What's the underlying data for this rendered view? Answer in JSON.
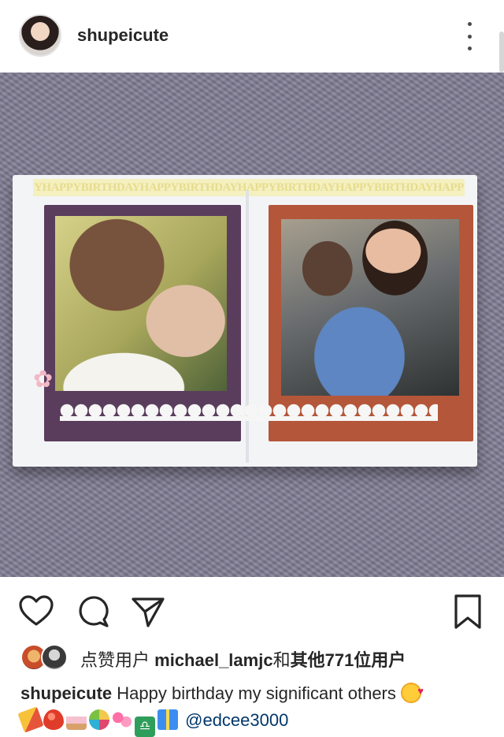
{
  "post": {
    "username": "shupeicute",
    "photo": {
      "banner_text": "YHAPPYBIRTHDAYHAPPYBIRTHDAYHAPPYBIRTHDAYHAPPYBIRTHDAYHAPP"
    },
    "actions": {
      "like_icon": "heart-icon",
      "comment_icon": "comment-icon",
      "share_icon": "paper-plane-icon",
      "save_icon": "bookmark-icon"
    },
    "likes": {
      "prefix": "点赞用户",
      "user": "michael_lamjc",
      "connector": "和",
      "others": "其他771位用户"
    },
    "caption": {
      "user": "shupeicute",
      "text": "Happy birthday my significant others",
      "mention": "@edcee3000"
    }
  },
  "colors": {
    "text": "#262626",
    "mention": "#00376b",
    "border": "#e3e3e3"
  }
}
